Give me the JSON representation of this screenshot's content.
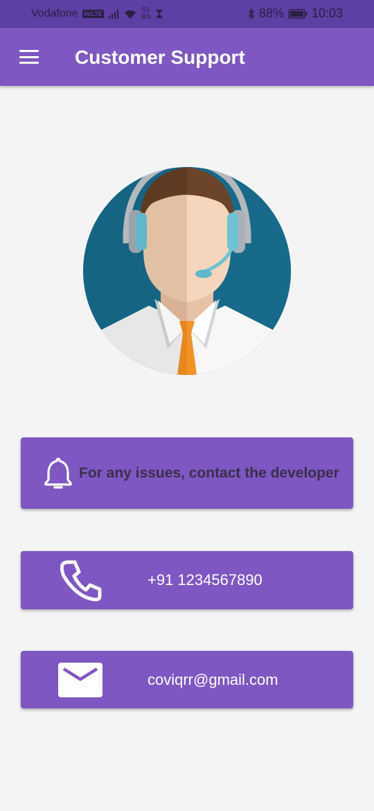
{
  "status_bar": {
    "carrier": "Vodafone",
    "volte": "VoLTE",
    "speed_value": "51",
    "speed_unit": "B/s",
    "battery": "88%",
    "time": "10:03"
  },
  "app_bar": {
    "title": "Customer Support",
    "menu_icon": "hamburger-menu-icon"
  },
  "colors": {
    "status_bar": "#5e3fa3",
    "primary": "#7e57c2",
    "background": "#f4f4f4"
  },
  "avatar": {
    "icon": "support-agent-headset-avatar"
  },
  "cards": {
    "notice": {
      "icon": "bell-icon",
      "text": "For any issues, contact the developer"
    },
    "phone": {
      "icon": "phone-icon",
      "text": "+91 1234567890"
    },
    "email": {
      "icon": "mail-icon",
      "text": "coviqrr@gmail.com"
    }
  }
}
